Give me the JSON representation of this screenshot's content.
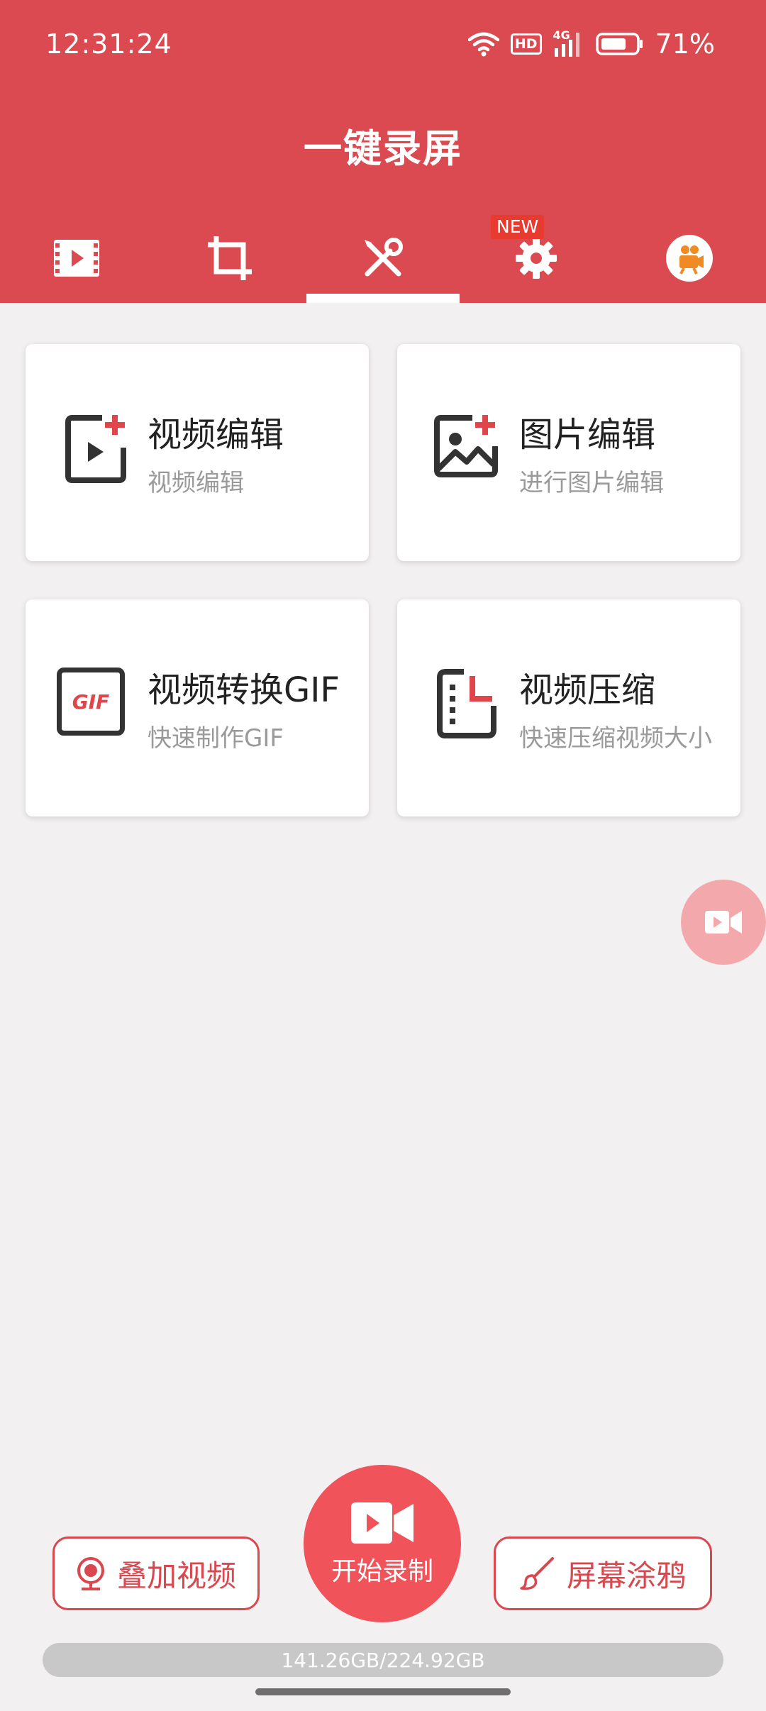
{
  "status_bar": {
    "time": "12:31:24",
    "hd": "HD",
    "network": "4G",
    "battery": "71%"
  },
  "app": {
    "title": "一键录屏"
  },
  "tabs": [
    {
      "icon": "film-icon",
      "active": false
    },
    {
      "icon": "crop-icon",
      "active": false
    },
    {
      "icon": "tools-icon",
      "active": true
    },
    {
      "icon": "gear-icon",
      "active": false,
      "badge": "NEW"
    },
    {
      "icon": "camera-avatar-icon",
      "active": false
    }
  ],
  "cards": [
    {
      "title": "视频编辑",
      "subtitle": "视频编辑",
      "icon": "video-edit-icon"
    },
    {
      "title": "图片编辑",
      "subtitle": "进行图片编辑",
      "icon": "image-edit-icon"
    },
    {
      "title": "视频转换GIF",
      "subtitle": "快速制作GIF",
      "icon": "gif-icon",
      "icon_text": "GIF"
    },
    {
      "title": "视频压缩",
      "subtitle": "快速压缩视频大小",
      "icon": "compress-icon"
    }
  ],
  "bottom": {
    "overlay_label": "叠加视频",
    "record_label": "开始录制",
    "doodle_label": "屏幕涂鸦",
    "storage": "141.26GB/224.92GB"
  },
  "colors": {
    "brand": "#da4a50",
    "record": "#f0545a",
    "float": "#f3a9ac",
    "accent_orange": "#f08a24"
  }
}
